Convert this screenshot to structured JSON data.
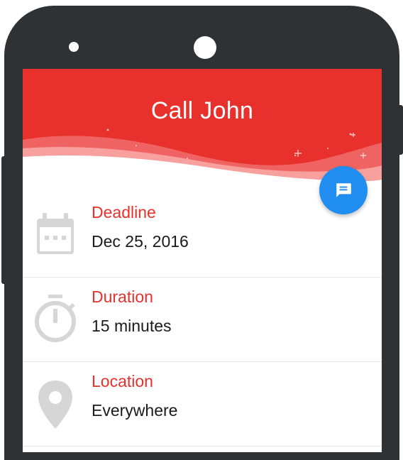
{
  "header": {
    "title": "Call John",
    "accent_color": "#e8312d"
  },
  "fab": {
    "icon": "message-icon",
    "color": "#1f8ef0"
  },
  "details": [
    {
      "icon": "calendar-icon",
      "label": "Deadline",
      "value": "Dec 25, 2016"
    },
    {
      "icon": "stopwatch-icon",
      "label": "Duration",
      "value": "15 minutes"
    },
    {
      "icon": "location-pin-icon",
      "label": "Location",
      "value": "Everywhere"
    }
  ]
}
